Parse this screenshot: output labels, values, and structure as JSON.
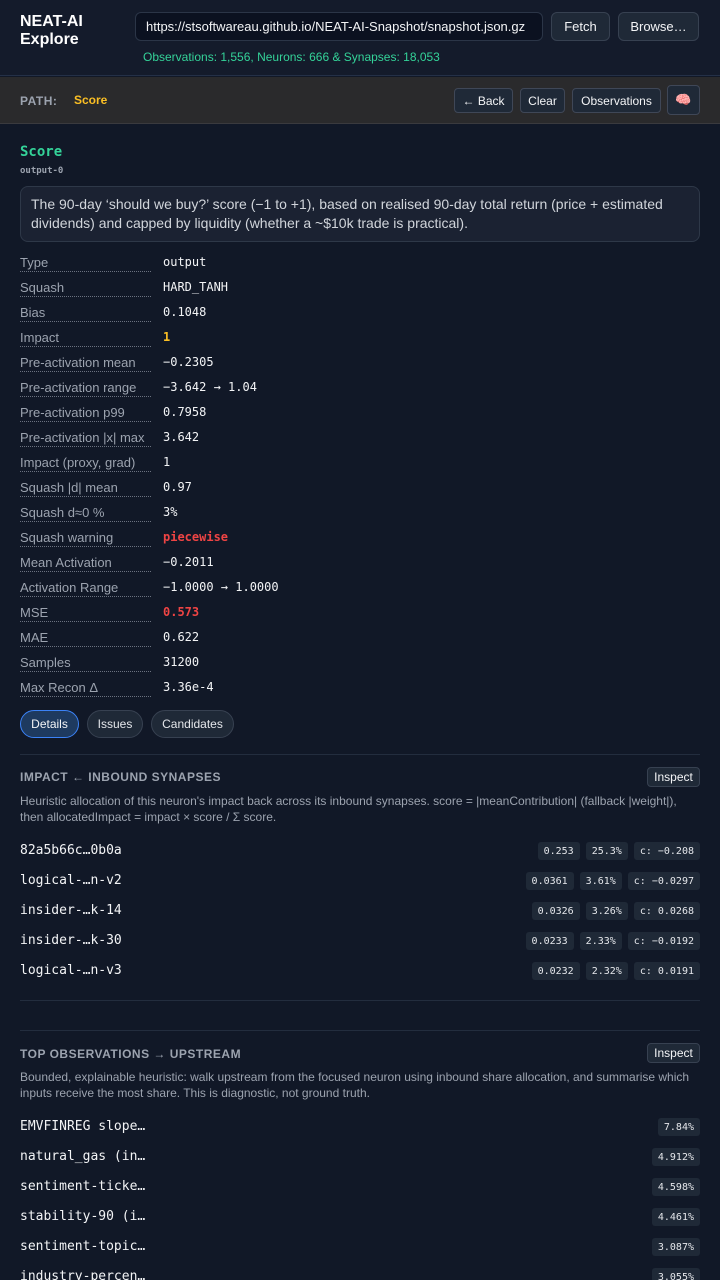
{
  "header": {
    "app_title": "NEAT-AI\nExplore",
    "url_value": "https://stsoftwareau.github.io/NEAT-AI-Snapshot/snapshot.json.gz",
    "fetch_label": "Fetch",
    "browse_label": "Browse…",
    "status": "Observations: 1,556, Neurons: 666 & Synapses: 18,053"
  },
  "pathbar": {
    "label": "PATH:",
    "value": "Score",
    "back_label": "← Back",
    "clear_label": "Clear",
    "observations_label": "Observations",
    "brain_icon": "🧠"
  },
  "neuron": {
    "title": "Score",
    "id": "output-0",
    "description": "The 90-day ‘should we buy?’ score (−1 to +1), based on realised 90-day total return (price + estimated dividends) and capped by liquidity (whether a ~$10k trade is practical).",
    "properties": [
      {
        "key": "Type",
        "value": "output",
        "style": ""
      },
      {
        "key": "Squash",
        "value": "HARD_TANH",
        "style": ""
      },
      {
        "key": "Bias",
        "value": "0.1048",
        "style": ""
      },
      {
        "key": "Impact",
        "value": "1",
        "style": "yellow"
      },
      {
        "key": "Pre-activation mean",
        "value": "−0.2305",
        "style": ""
      },
      {
        "key": "Pre-activation range",
        "value": "−3.642 → 1.04",
        "style": ""
      },
      {
        "key": "Pre-activation p99",
        "value": "0.7958",
        "style": ""
      },
      {
        "key": "Pre-activation |x| max",
        "value": "3.642",
        "style": ""
      },
      {
        "key": "Impact (proxy, grad)",
        "value": "1",
        "style": ""
      },
      {
        "key": "Squash |d| mean",
        "value": "0.97",
        "style": ""
      },
      {
        "key": "Squash d≈0 %",
        "value": "3%",
        "style": ""
      },
      {
        "key": "Squash warning",
        "value": "piecewise",
        "style": "red"
      },
      {
        "key": "Mean Activation",
        "value": "−0.2011",
        "style": ""
      },
      {
        "key": "Activation Range",
        "value": "−1.0000 → 1.0000",
        "style": ""
      },
      {
        "key": "MSE",
        "value": "0.573",
        "style": "red"
      },
      {
        "key": "MAE",
        "value": "0.622",
        "style": ""
      },
      {
        "key": "Samples",
        "value": "31200",
        "style": ""
      },
      {
        "key": "Max Recon Δ",
        "value": "3.36e-4",
        "style": ""
      }
    ]
  },
  "tabs": {
    "details": "Details",
    "issues": "Issues",
    "candidates": "Candidates"
  },
  "impact_section": {
    "title": "IMPACT ← INBOUND SYNAPSES",
    "inspect_label": "Inspect",
    "description": "Heuristic allocation of this neuron's impact back across its inbound synapses. score = |meanContribution| (fallback |weight|), then allocatedImpact = impact × score / Σ score.",
    "rows": [
      {
        "name": "82a5b66c…0b0a",
        "impact": "0.253",
        "share": "25.3%",
        "contrib": "c: −0.208"
      },
      {
        "name": "logical-…n-v2",
        "impact": "0.0361",
        "share": "3.61%",
        "contrib": "c: −0.0297"
      },
      {
        "name": "insider-…k-14",
        "impact": "0.0326",
        "share": "3.26%",
        "contrib": "c: 0.0268"
      },
      {
        "name": "insider-…k-30",
        "impact": "0.0233",
        "share": "2.33%",
        "contrib": "c: −0.0192"
      },
      {
        "name": "logical-…n-v3",
        "impact": "0.0232",
        "share": "2.32%",
        "contrib": "c: 0.0191"
      }
    ]
  },
  "observations_section": {
    "title": "TOP OBSERVATIONS → UPSTREAM",
    "inspect_label": "Inspect",
    "description": "Bounded, explainable heuristic: walk upstream from the focused neuron using inbound share allocation, and summarise which inputs receive the most share. This is diagnostic, not ground truth.",
    "rows": [
      {
        "name": "EMVFINREG slope…",
        "share": "7.84%"
      },
      {
        "name": "natural_gas (in…",
        "share": "4.912%"
      },
      {
        "name": "sentiment-ticke…",
        "share": "4.598%"
      },
      {
        "name": "stability-90 (i…",
        "share": "4.461%"
      },
      {
        "name": "sentiment-topic…",
        "share": "3.087%"
      },
      {
        "name": "industry-percen…",
        "share": "3.055%"
      }
    ]
  }
}
